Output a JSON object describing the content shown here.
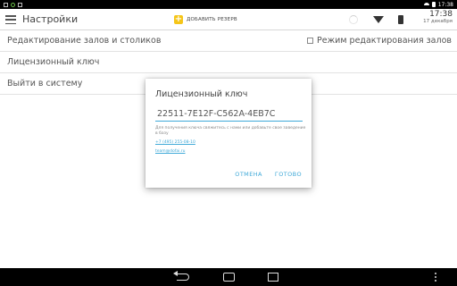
{
  "status_bar": {
    "time": "17:38"
  },
  "app_bar": {
    "title": "Настройки",
    "add_reserve_label": "ДОБАВИТЬ РЕЗЕРВ",
    "clock_time": "17:38",
    "clock_date": "17 декабря"
  },
  "settings": {
    "edit_halls": "Редактирование залов и столиков",
    "edit_mode": "Режим редактирования залов",
    "license_key": "Лицензионный ключ",
    "logout": "Выйти в систему"
  },
  "dialog": {
    "title": "Лицензионный ключ",
    "key_value": "22511-7E12F-C562A-4EB7C",
    "hint": "Для получения ключа свяжитесь с нами или добавьте свое заведение в базу",
    "phone": "+7 (495) 255-08-10",
    "email": "team@dofai.ru",
    "cancel": "ОТМЕНА",
    "ok": "ГОТОВО"
  },
  "colors": {
    "accent": "#3fa9d8",
    "add_icon": "#f5c518",
    "status_bar": "#000000"
  },
  "icons": [
    "menu-icon",
    "plus-icon",
    "sync-spinner-icon",
    "wifi-icon",
    "device-icon",
    "back-icon",
    "home-icon",
    "recents-icon",
    "more-icon"
  ]
}
